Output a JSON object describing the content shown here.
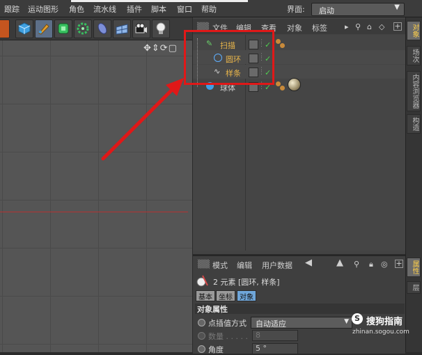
{
  "menubar": {
    "items": [
      "跟踪",
      "运动图形",
      "角色",
      "流水线",
      "插件",
      "脚本",
      "窗口",
      "帮助"
    ],
    "interface_label": "界面:",
    "interface_value": "启动"
  },
  "toolbar": {
    "icons": [
      "undo-icon",
      "cube-icon",
      "pen-spline-icon",
      "subdivision-icon",
      "cloner-icon",
      "deformer-icon",
      "floor-icon",
      "camera-icon",
      "light-icon"
    ]
  },
  "viewport": {
    "nav_glyphs": "✥⇕⟳▢"
  },
  "object_manager": {
    "menu": [
      "文件",
      "编辑",
      "查看",
      "对象",
      "标签"
    ],
    "objects": [
      {
        "name": "扫描",
        "icon": "sweep-icon",
        "color": "#e8b54a"
      },
      {
        "name": "圆环",
        "icon": "circle-icon",
        "color": "#e8b54a"
      },
      {
        "name": "样条",
        "icon": "spline-icon",
        "color": "#e8b54a"
      },
      {
        "name": "球体",
        "icon": "sphere-icon",
        "color": "#cfcfcf"
      }
    ]
  },
  "right_tabs": [
    "对象",
    "场次",
    "内容浏览器",
    "构造"
  ],
  "attribute_manager": {
    "menu": [
      "模式",
      "编辑",
      "用户数据"
    ],
    "info": "2 元素 [圆环, 样条]",
    "tabs": [
      "基本",
      "坐标",
      "对象"
    ],
    "section_title": "对象属性",
    "fields": {
      "interp_label": "点插值方式",
      "interp_value": "自动适应",
      "count_label": "数量 . . . . .",
      "count_value": "8",
      "angle_label": "角度",
      "angle_value": "5 °"
    }
  },
  "side_tab_attr": [
    "属性",
    "层"
  ],
  "watermark": {
    "brand": "搜狗指南",
    "url": "zhinan.sogou.com"
  },
  "colors": {
    "highlight": "#e01818",
    "accent_blue": "#6fa6d9",
    "check_green": "#4fd04f"
  }
}
